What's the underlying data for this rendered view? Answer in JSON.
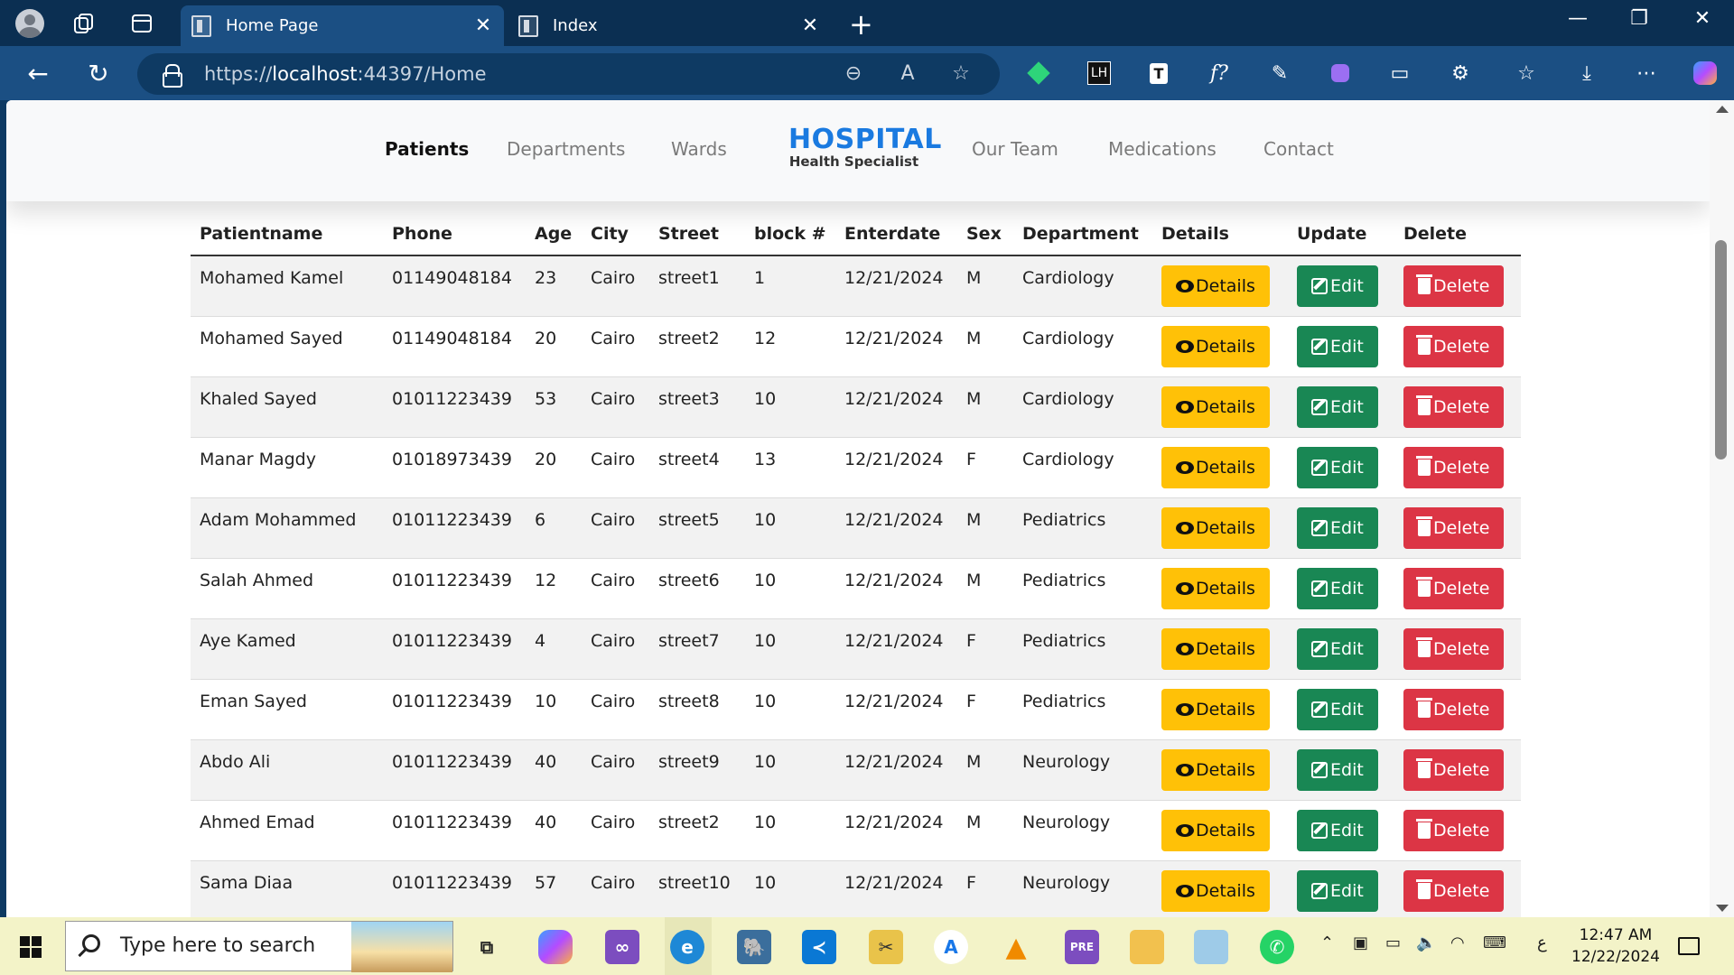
{
  "browser": {
    "tabs": [
      {
        "title": "Home Page",
        "active": true
      },
      {
        "title": "Index",
        "active": false
      }
    ],
    "url_scheme": "https://",
    "url_host": "localhost",
    "url_rest": ":44397/Home"
  },
  "site": {
    "brand_title": "HOSPITAL",
    "brand_subtitle": "Health Specialist",
    "nav_left": [
      "Patients",
      "Departments",
      "Wards"
    ],
    "nav_right": [
      "Our Team",
      "Medications",
      "Contact"
    ]
  },
  "table": {
    "headers": [
      "Patientname",
      "Phone",
      "Age",
      "City",
      "Street",
      "block #",
      "Enterdate",
      "Sex",
      "Department",
      "Details",
      "Update",
      "Delete"
    ],
    "rows": [
      [
        "Mohamed Kamel",
        "01149048184",
        "23",
        "Cairo",
        "street1",
        "1",
        "12/21/2024",
        "M",
        "Cardiology"
      ],
      [
        "Mohamed Sayed",
        "01149048184",
        "20",
        "Cairo",
        "street2",
        "12",
        "12/21/2024",
        "M",
        "Cardiology"
      ],
      [
        "Khaled Sayed",
        "01011223439",
        "53",
        "Cairo",
        "street3",
        "10",
        "12/21/2024",
        "M",
        "Cardiology"
      ],
      [
        "Manar Magdy",
        "01018973439",
        "20",
        "Cairo",
        "street4",
        "13",
        "12/21/2024",
        "F",
        "Cardiology"
      ],
      [
        "Adam Mohammed",
        "01011223439",
        "6",
        "Cairo",
        "street5",
        "10",
        "12/21/2024",
        "M",
        "Pediatrics"
      ],
      [
        "Salah Ahmed",
        "01011223439",
        "12",
        "Cairo",
        "street6",
        "10",
        "12/21/2024",
        "M",
        "Pediatrics"
      ],
      [
        "Aye Kamed",
        "01011223439",
        "4",
        "Cairo",
        "street7",
        "10",
        "12/21/2024",
        "F",
        "Pediatrics"
      ],
      [
        "Eman Sayed",
        "01011223439",
        "10",
        "Cairo",
        "street8",
        "10",
        "12/21/2024",
        "F",
        "Pediatrics"
      ],
      [
        "Abdo Ali",
        "01011223439",
        "40",
        "Cairo",
        "street9",
        "10",
        "12/21/2024",
        "M",
        "Neurology"
      ],
      [
        "Ahmed Emad",
        "01011223439",
        "40",
        "Cairo",
        "street2",
        "10",
        "12/21/2024",
        "M",
        "Neurology"
      ],
      [
        "Sama Diaa",
        "01011223439",
        "57",
        "Cairo",
        "street10",
        "10",
        "12/21/2024",
        "F",
        "Neurology"
      ]
    ],
    "details_label": "Details",
    "edit_label": "Edit",
    "delete_label": "Delete"
  },
  "taskbar": {
    "search_placeholder": "Type here to search",
    "time": "12:47 AM",
    "date": "12/22/2024",
    "language": "ع"
  },
  "colors": {
    "brand": "#1a7ae0",
    "details": "#ffc107",
    "edit": "#198754",
    "delete": "#dc3545",
    "browser_frame": "#0b2f52",
    "toolbar": "#1b4f83"
  }
}
